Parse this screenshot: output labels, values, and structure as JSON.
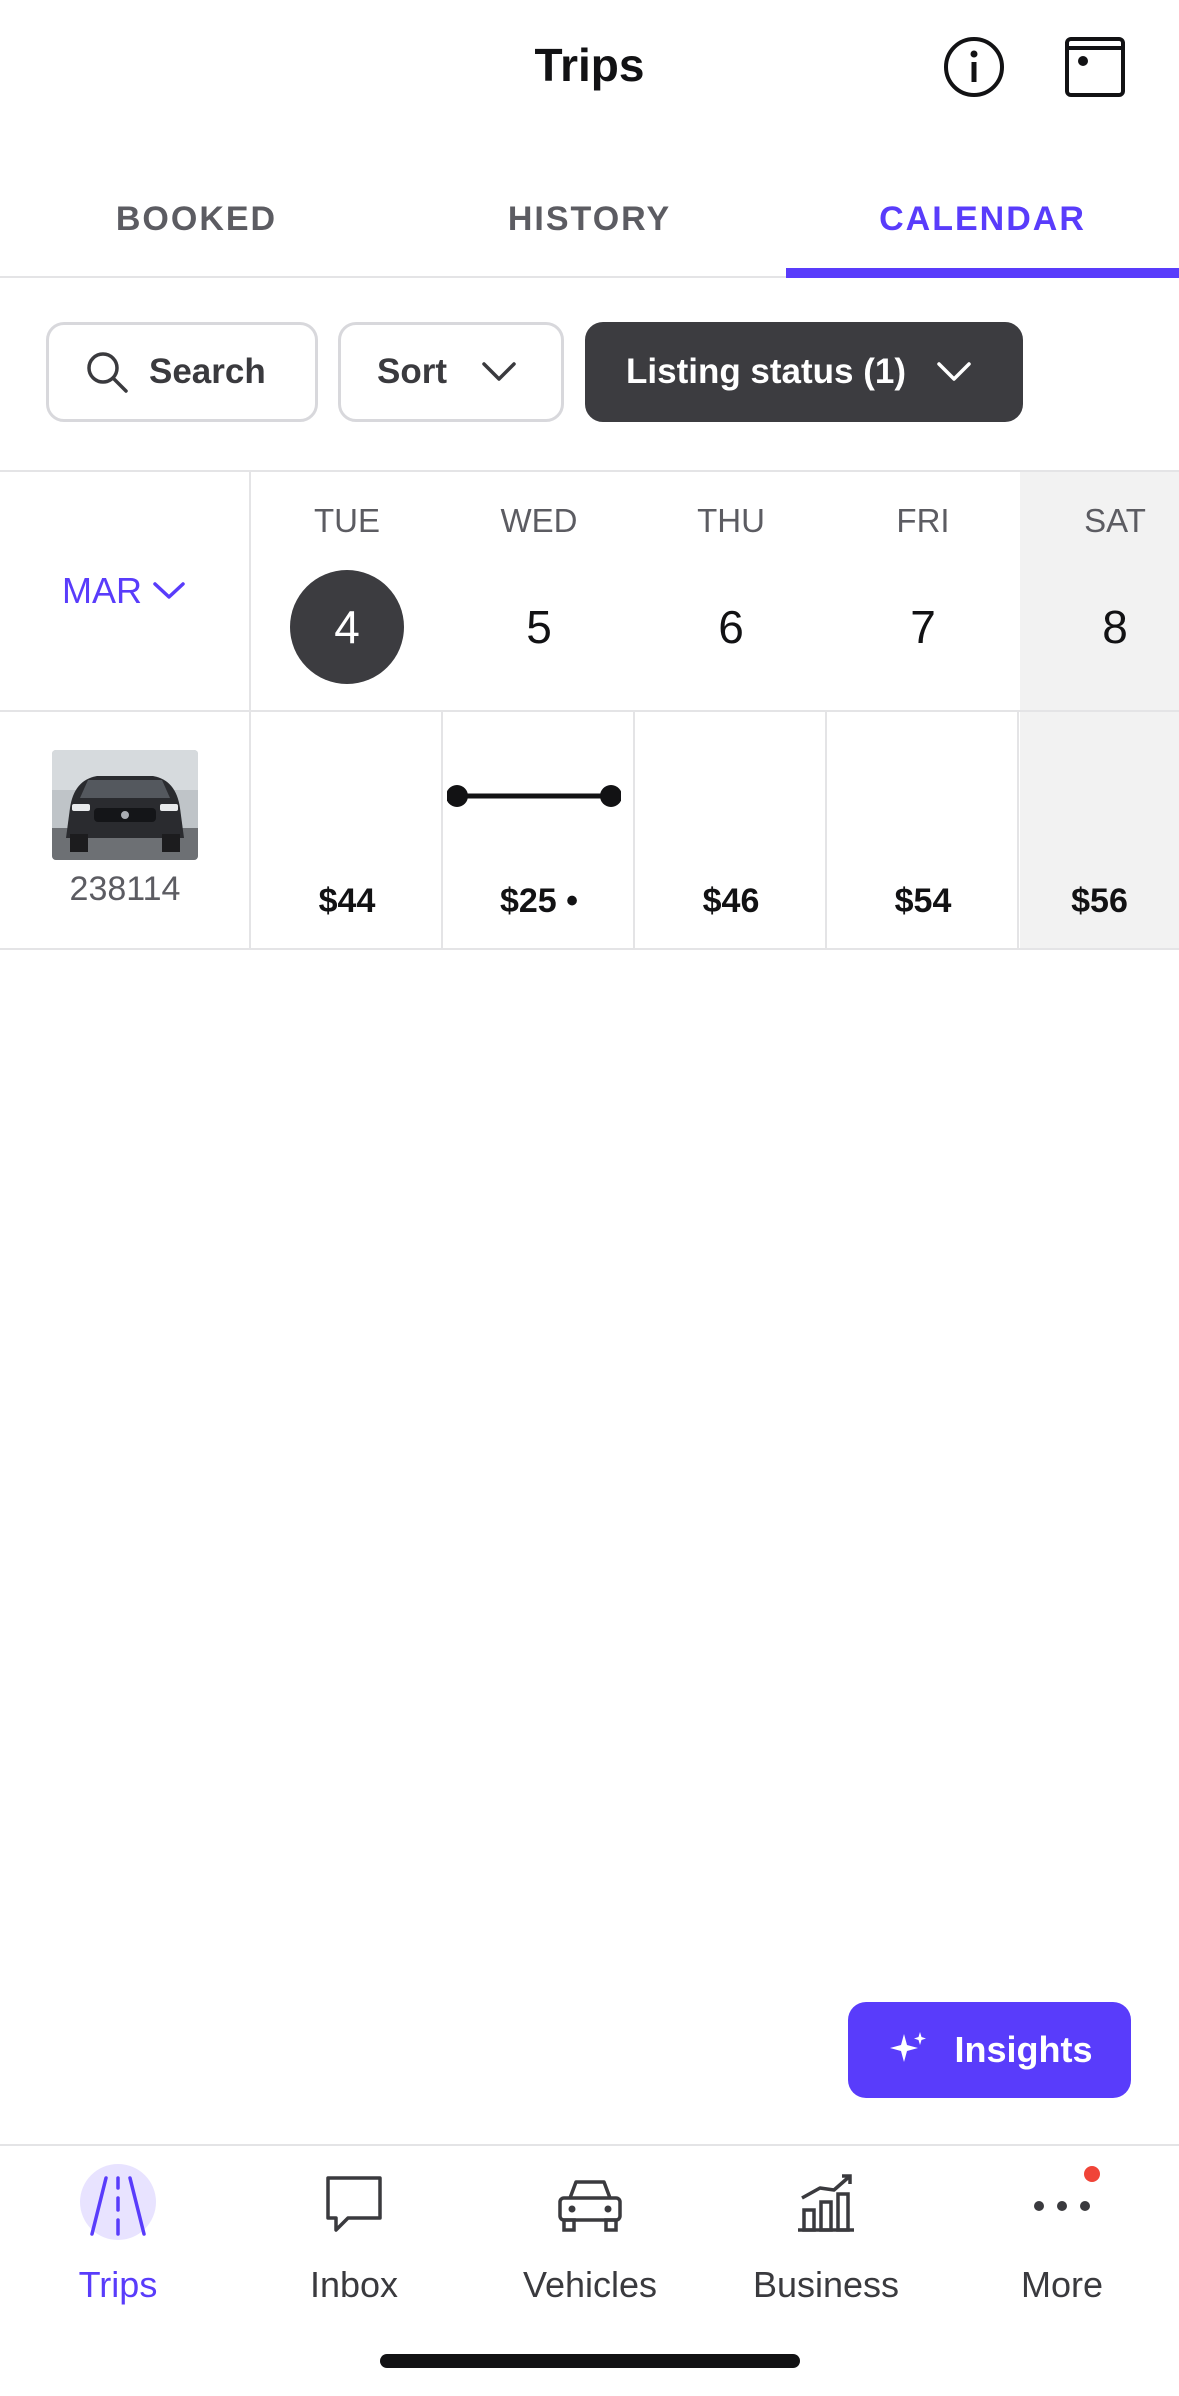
{
  "header": {
    "title": "Trips",
    "info_icon": "info-icon",
    "calendar_icon": "calendar-icon"
  },
  "tabs": [
    {
      "label": "BOOKED",
      "active": false
    },
    {
      "label": "HISTORY",
      "active": false
    },
    {
      "label": "CALENDAR",
      "active": true
    }
  ],
  "filters": {
    "search_label": "Search",
    "sort_label": "Sort",
    "status_label": "Listing status (1)"
  },
  "calendar": {
    "month": "MAR",
    "days": [
      {
        "name": "TUE",
        "num": "4",
        "today": true
      },
      {
        "name": "WED",
        "num": "5",
        "today": false
      },
      {
        "name": "THU",
        "num": "6",
        "today": false
      },
      {
        "name": "FRI",
        "num": "7",
        "today": false
      },
      {
        "name": "SAT",
        "num": "8",
        "today": false
      }
    ],
    "vehicle": {
      "id": "238114",
      "prices": [
        "$44",
        "$25 •",
        "$46",
        "$54",
        "$56"
      ]
    }
  },
  "insights_label": "Insights",
  "bottom_nav": [
    {
      "label": "Trips",
      "icon": "road-icon",
      "active": true
    },
    {
      "label": "Inbox",
      "icon": "chat-bubble-icon",
      "active": false
    },
    {
      "label": "Vehicles",
      "icon": "car-icon",
      "active": false
    },
    {
      "label": "Business",
      "icon": "bar-chart-icon",
      "active": false
    },
    {
      "label": "More",
      "icon": "more-dots-icon",
      "active": false
    }
  ],
  "colors": {
    "accent": "#593cfb",
    "dark_chip": "#3c3c40",
    "notification_dot": "#f04438",
    "weekend_bg": "#f2f2f2"
  }
}
